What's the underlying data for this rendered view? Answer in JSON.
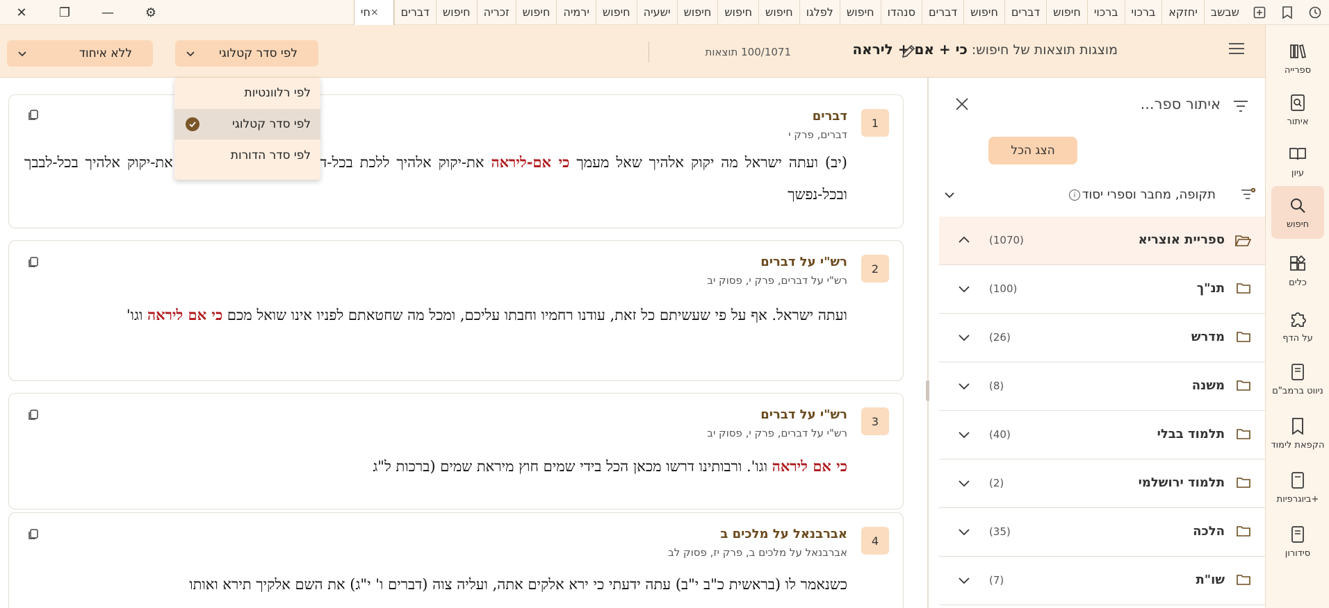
{
  "window_controls": {
    "close": "✕",
    "restore": "❐",
    "minimize": "—",
    "settings": "⚙"
  },
  "tabs": [
    {
      "label": "שבשב"
    },
    {
      "label": "יחזקא"
    },
    {
      "label": "ברכוי"
    },
    {
      "label": "ברכוי"
    },
    {
      "label": "חיפוש"
    },
    {
      "label": "דברים"
    },
    {
      "label": "חיפוש"
    },
    {
      "label": "דברים"
    },
    {
      "label": "סנהדו"
    },
    {
      "label": "חיפוש"
    },
    {
      "label": "לפלגו"
    },
    {
      "label": "חיפוש"
    },
    {
      "label": "חיפוש"
    },
    {
      "label": "חיפוש"
    },
    {
      "label": "ישעיה"
    },
    {
      "label": "חיפוש"
    },
    {
      "label": "ירמיה"
    },
    {
      "label": "חיפוש"
    },
    {
      "label": "זכריה"
    },
    {
      "label": "חיפוש"
    },
    {
      "label": "דברים"
    }
  ],
  "active_tab": {
    "label": "חי",
    "close": "×"
  },
  "rail": {
    "items": [
      {
        "label": "ספרייה",
        "icon": "library-icon"
      },
      {
        "label": "איתור",
        "icon": "find-icon"
      },
      {
        "label": "עיון",
        "icon": "book-open-icon"
      },
      {
        "label": "חיפוש",
        "icon": "search-icon"
      },
      {
        "label": "כלים",
        "icon": "tools-icon"
      },
      {
        "label": "על הדף",
        "icon": "puzzle-icon"
      },
      {
        "label": "ניווט ברמב\"ם",
        "icon": "rambam-icon"
      },
      {
        "label": "הקפאת לימוד",
        "icon": "bookmark-icon"
      },
      {
        "label": "ביוגרפיות+",
        "icon": "biography-icon"
      },
      {
        "label": "סידורון",
        "icon": "siddur-icon"
      }
    ]
  },
  "header": {
    "title_prefix": "מוצגות תוצאות של חיפוש:",
    "query": "כי + אם + ליראה",
    "results_count": "100/1071 תוצאות",
    "sort_label": "לפי סדר קטלוגי",
    "group_label": "ללא איחוד"
  },
  "sort_options": [
    {
      "label": "לפי רלוונטיות"
    },
    {
      "label": "לפי סדר קטלוגי"
    },
    {
      "label": "לפי סדר הדורות"
    }
  ],
  "results": [
    {
      "num": "1",
      "title": "דברים",
      "sub": "דברים, פרק י",
      "t1": "(יב) ועתה ישראל מה יקוק אלהיך שאל מעמך ",
      "h1": "כי אם-ליראה",
      "t2": " את-יקוק אלהיך ללכת בכל-דרכיו ולאהבה אתו ולעבד את-יקוק אלהיך בכל-לבבך ובכל-נפשך"
    },
    {
      "num": "2",
      "title": "רש\"י על דברים",
      "sub": "רש\"י על דברים, פרק י, פסוק יב",
      "t1": "ועתה ישראל. אף על פי שעשיתם כל זאת, עודנו רחמיו וחבתו עליכם, ומכל מה שחטאתם לפניו אינו שואל מכם ",
      "h1": "כי אם ליראה",
      "t2": " וגו'"
    },
    {
      "num": "3",
      "title": "רש\"י על דברים",
      "sub": "רש\"י על דברים, פרק י, פסוק יב",
      "t1": "",
      "h1": "כי אם ליראה",
      "t2": " וגו'. ורבותינו דרשו מכאן הכל בידי שמים חוץ מיראת שמים (ברכות ל\"ג"
    },
    {
      "num": "4",
      "title": "אברבנאל על מלכים ב",
      "sub": "אברבנאל על מלכים ב, פרק יז, פסוק לב",
      "t1": "כשנאמר לו (בראשית כ\"ב י\"ב) עתה ידעתי כי ירא אלקים אתה, ועליה צוה (דברים ו' י\"ג) את השם אלקיך תירא ואותו",
      "h1": "",
      "t2": ""
    }
  ],
  "filter": {
    "search_placeholder": "איתור ספר...",
    "show_all": "הצג הכל",
    "period_label": "תקופה, מחבר וספרי יסוד",
    "info": "i",
    "library": {
      "name": "ספריית אוצריא",
      "count": "(1070)"
    },
    "categories": [
      {
        "name": "תנ\"ך",
        "count": "(100)"
      },
      {
        "name": "מדרש",
        "count": "(26)"
      },
      {
        "name": "משנה",
        "count": "(8)"
      },
      {
        "name": "תלמוד בבלי",
        "count": "(40)"
      },
      {
        "name": "תלמוד ירושלמי",
        "count": "(2)"
      },
      {
        "name": "הלכה",
        "count": "(35)"
      },
      {
        "name": "שו\"ת",
        "count": "(7)"
      }
    ]
  },
  "colors": {
    "accent": "#6b4a1e",
    "highlight": "#b0191d",
    "header_bg": "#fcebd8",
    "dropdown_bg": "#fbd7b8"
  }
}
